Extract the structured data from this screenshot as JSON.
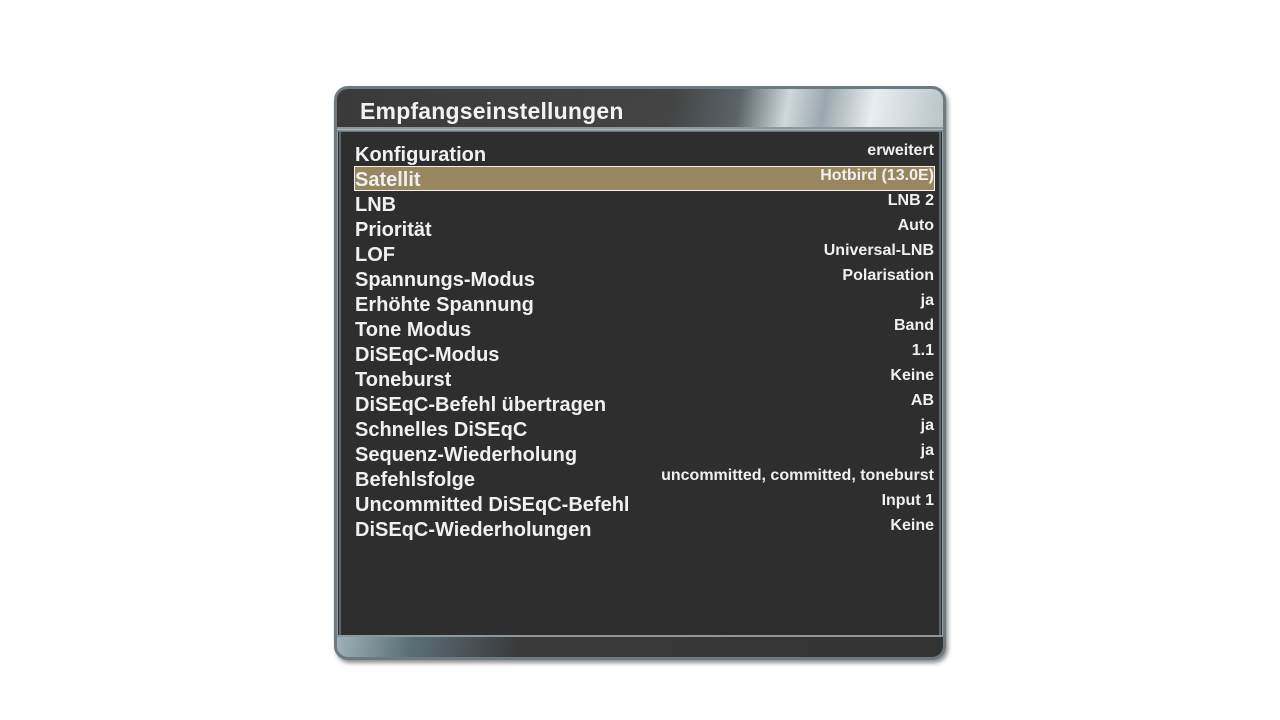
{
  "window": {
    "title": "Empfangseinstellungen"
  },
  "colors": {
    "background": "#2e2e2e",
    "selection": "#978660",
    "text": "#f0f0f0"
  },
  "settings": [
    {
      "label": "Konfiguration",
      "value": "erweitert",
      "selected": false
    },
    {
      "label": "Satellit",
      "value": "Hotbird (13.0E)",
      "selected": true
    },
    {
      "label": "LNB",
      "value": "LNB 2",
      "selected": false
    },
    {
      "label": "Priorität",
      "value": "Auto",
      "selected": false
    },
    {
      "label": "LOF",
      "value": "Universal-LNB",
      "selected": false
    },
    {
      "label": "Spannungs-Modus",
      "value": "Polarisation",
      "selected": false
    },
    {
      "label": "Erhöhte Spannung",
      "value": "ja",
      "selected": false
    },
    {
      "label": "Tone Modus",
      "value": "Band",
      "selected": false
    },
    {
      "label": "DiSEqC-Modus",
      "value": "1.1",
      "selected": false
    },
    {
      "label": "Toneburst",
      "value": "Keine",
      "selected": false
    },
    {
      "label": "DiSEqC-Befehl übertragen",
      "value": "AB",
      "selected": false
    },
    {
      "label": "Schnelles DiSEqC",
      "value": "ja",
      "selected": false
    },
    {
      "label": "Sequenz-Wiederholung",
      "value": "ja",
      "selected": false
    },
    {
      "label": "Befehlsfolge",
      "value": "uncommitted, committed, toneburst",
      "selected": false
    },
    {
      "label": "Uncommitted DiSEqC-Befehl",
      "value": "Input 1",
      "selected": false
    },
    {
      "label": "DiSEqC-Wiederholungen",
      "value": "Keine",
      "selected": false
    }
  ]
}
